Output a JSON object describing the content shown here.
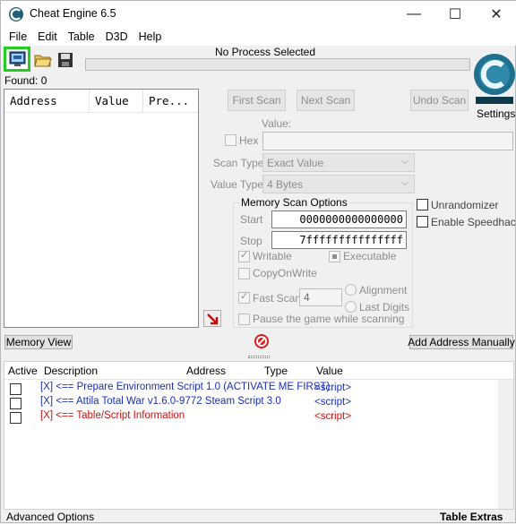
{
  "window": {
    "title": "Cheat Engine 6.5",
    "minimize_glyph": "—",
    "maximize_glyph": "☐",
    "close_glyph": "✕"
  },
  "menu": [
    "File",
    "Edit",
    "Table",
    "D3D",
    "Help"
  ],
  "toolbar": {
    "process_label": "No Process Selected",
    "found_label": "Found: 0",
    "settings_label": "Settings",
    "highlight_color": "#22cc22"
  },
  "results_columns": [
    "Address",
    "Value",
    "Pre..."
  ],
  "scan": {
    "first_scan": "First Scan",
    "next_scan": "Next Scan",
    "undo_scan": "Undo Scan",
    "value_label": "Value:",
    "hex_label": "Hex",
    "scan_type_label": "Scan Type",
    "scan_type_value": "Exact Value",
    "value_type_label": "Value Type",
    "value_type_value": "4 Bytes",
    "unrandomizer": "Unrandomizer",
    "enable_speedhack": "Enable Speedhack"
  },
  "memory_options": {
    "title": "Memory Scan Options",
    "start_label": "Start",
    "start_value": "0000000000000000",
    "stop_label": "Stop",
    "stop_value": "7fffffffffffffff",
    "writable": "Writable",
    "executable": "Executable",
    "copy_on_write": "CopyOnWrite",
    "fast_scan": "Fast Scan",
    "fast_scan_value": "4",
    "alignment": "Alignment",
    "last_digits": "Last Digits",
    "pause_game": "Pause the game while scanning"
  },
  "bottom_buttons": {
    "memory_view": "Memory View",
    "add_address_manually": "Add Address Manually"
  },
  "address_list": {
    "columns": [
      "Active",
      "Description",
      "Address",
      "Type",
      "Value"
    ],
    "rows": [
      {
        "description": "[X] <== Prepare Environment Script 1.0 (ACTIVATE ME FIRST)",
        "value": "<script>",
        "color": "#1a2eb8"
      },
      {
        "description": "[X] <== Attila Total War v1.6.0-9772 Steam Script 3.0",
        "value": "<script>",
        "color": "#1a2eb8"
      },
      {
        "description": "[X] <== Table/Script Information",
        "value": "<script>",
        "color": "#cc1111"
      }
    ]
  },
  "status": {
    "advanced_options": "Advanced Options",
    "table_extras": "Table Extras"
  }
}
